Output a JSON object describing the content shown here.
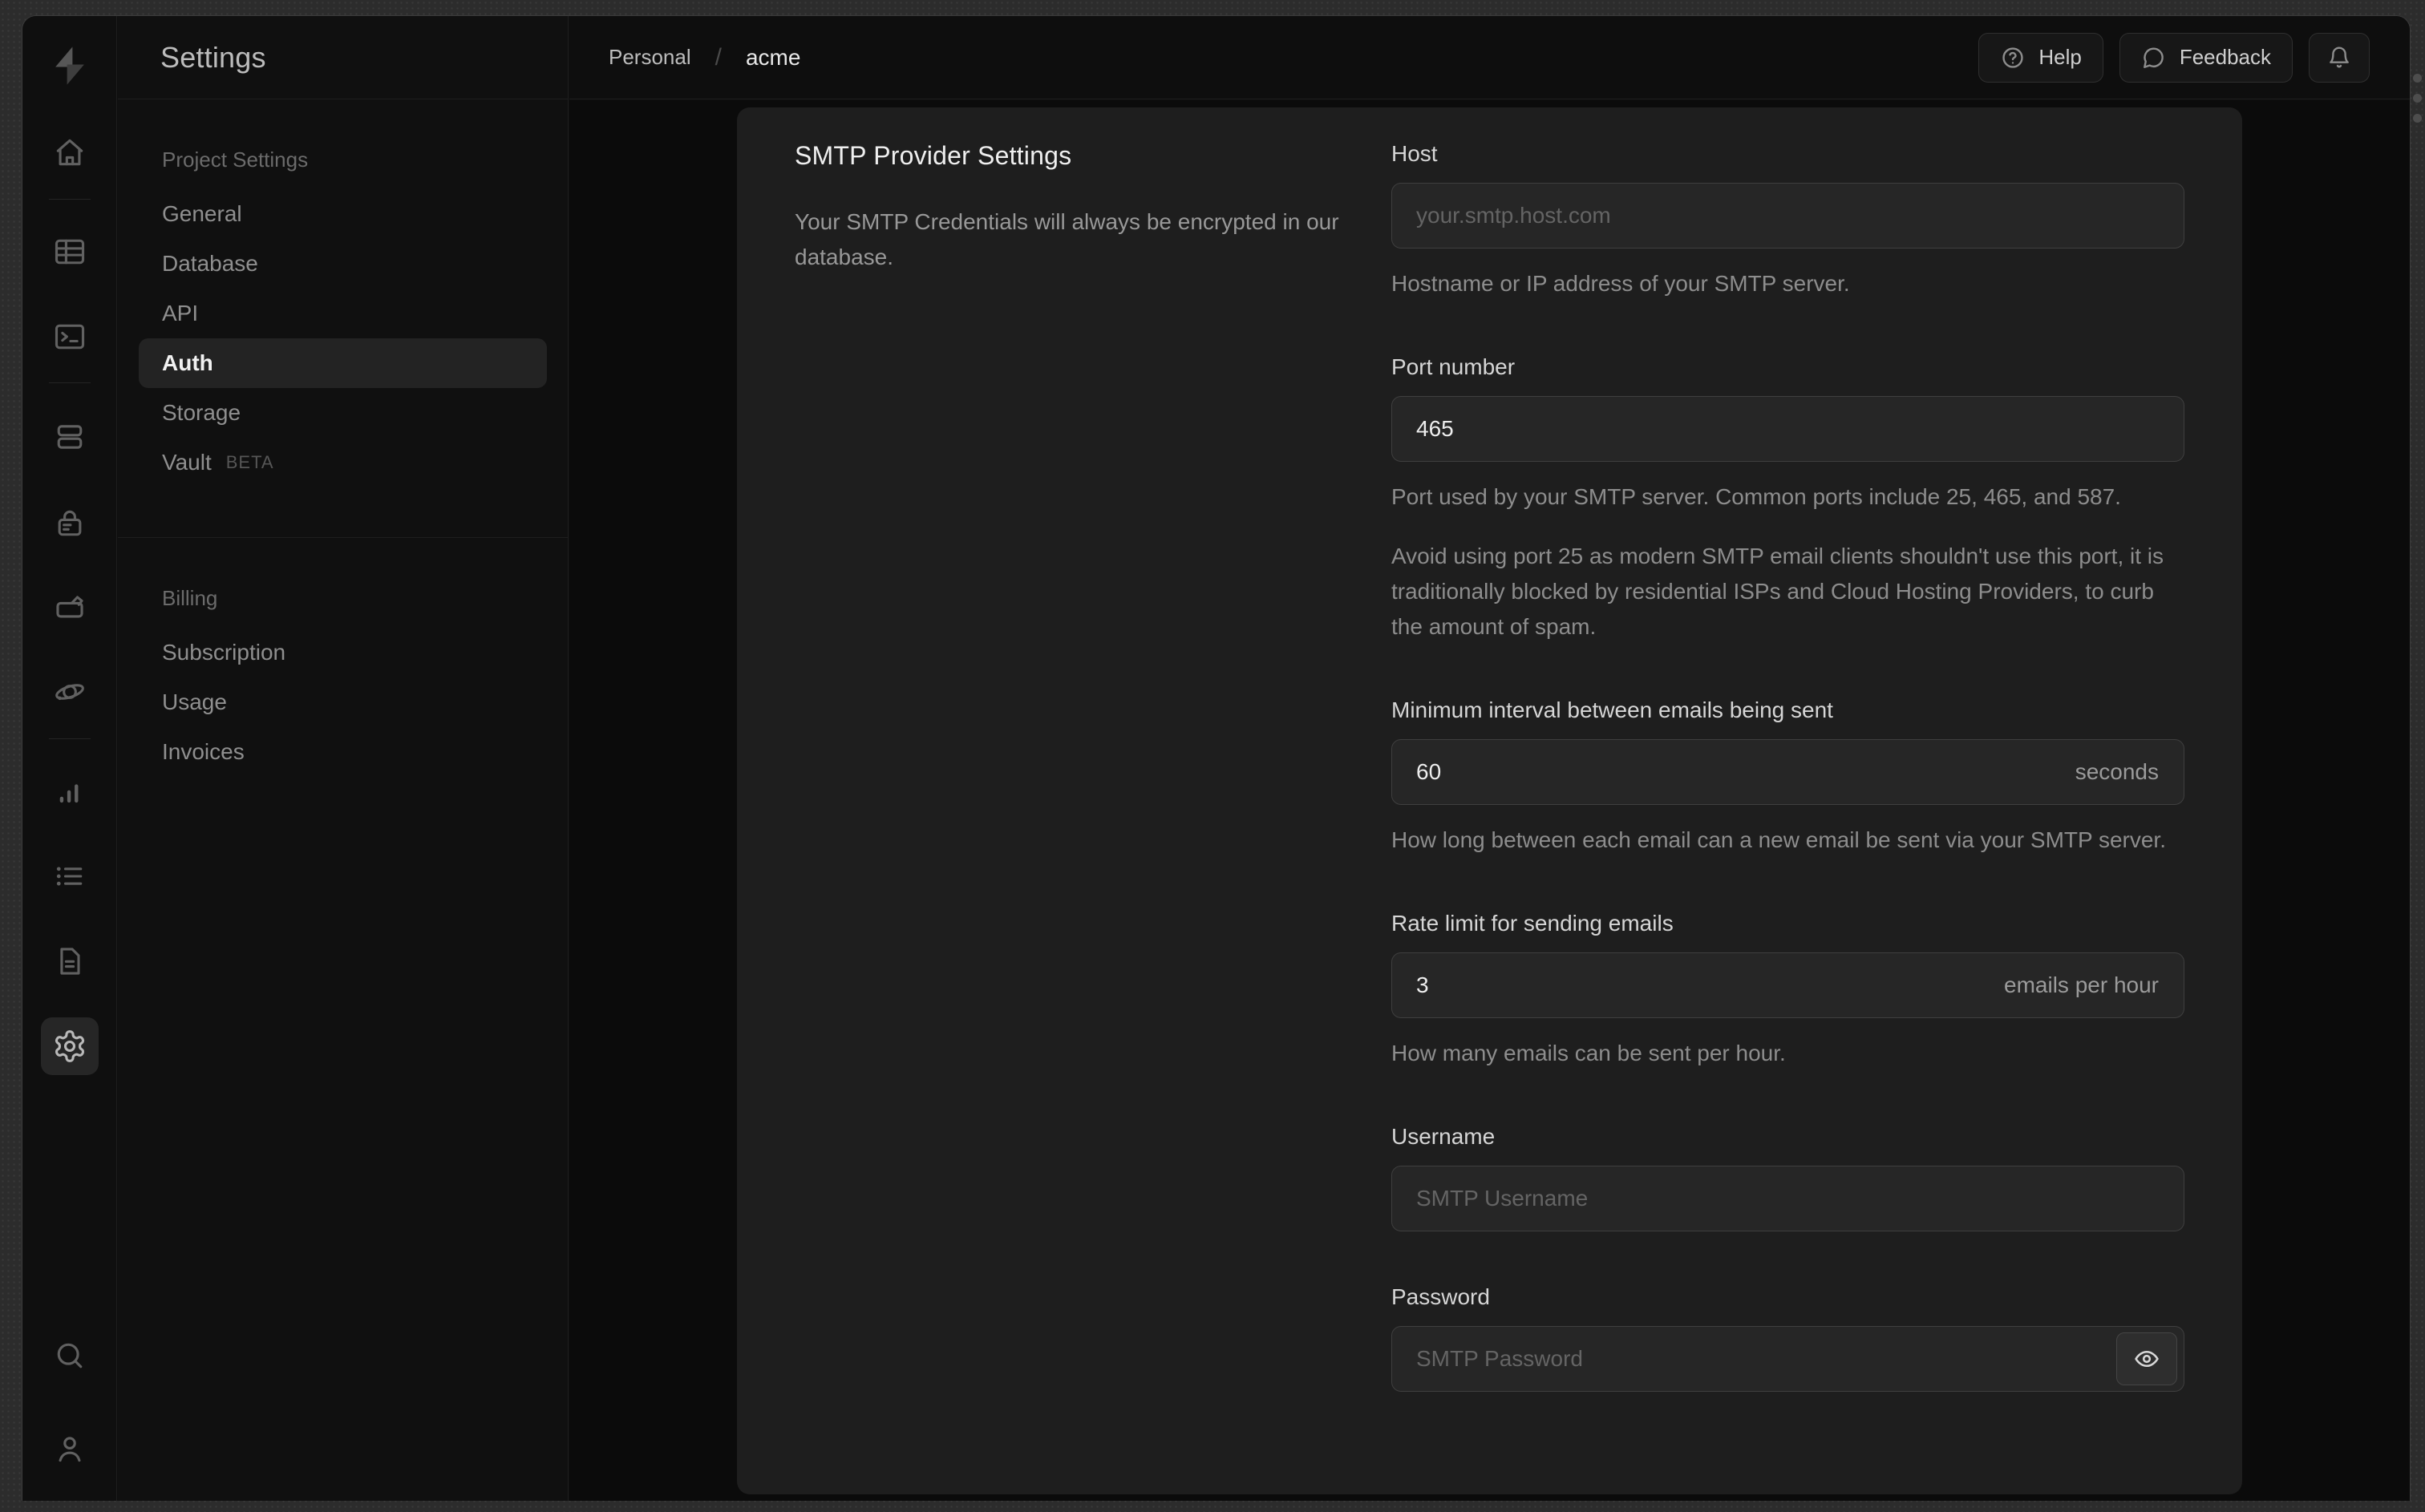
{
  "nav": {
    "title": "Settings",
    "sections": [
      {
        "label": "Project Settings",
        "items": [
          "General",
          "Database",
          "API",
          "Auth",
          "Storage",
          "Vault"
        ]
      },
      {
        "label": "Billing",
        "items": [
          "Subscription",
          "Usage",
          "Invoices"
        ]
      }
    ],
    "active_item": "Auth",
    "vault_badge": "BETA"
  },
  "breadcrumb": {
    "org": "Personal",
    "separator": "/",
    "project": "acme"
  },
  "topbar": {
    "help_label": "Help",
    "feedback_label": "Feedback"
  },
  "smtp": {
    "title": "SMTP Provider Settings",
    "description": "Your SMTP Credentials will always be encrypted in our database.",
    "host": {
      "label": "Host",
      "placeholder": "your.smtp.host.com",
      "helper": "Hostname or IP address of your SMTP server."
    },
    "port": {
      "label": "Port number",
      "value": "465",
      "helper": "Port used by your SMTP server. Common ports include 25, 465, and 587.",
      "note": "Avoid using port 25 as modern SMTP email clients shouldn't use this port, it is traditionally blocked by residential ISPs and Cloud Hosting Providers, to curb the amount of spam."
    },
    "interval": {
      "label": "Minimum interval between emails being sent",
      "value": "60",
      "suffix": "seconds",
      "helper": "How long between each email can a new email be sent via your SMTP server."
    },
    "rate": {
      "label": "Rate limit for sending emails",
      "value": "3",
      "suffix": "emails per hour",
      "helper": "How many emails can be sent per hour."
    },
    "username": {
      "label": "Username",
      "placeholder": "SMTP Username"
    },
    "password": {
      "label": "Password",
      "placeholder": "SMTP Password"
    }
  },
  "colors": {
    "desktop_bg": "#2c2c2c",
    "window_bg": "#0e0e0e",
    "panel_card_bg": "#1e1e1e",
    "input_bg": "#262626",
    "input_border": "#3f3f3f",
    "border_subtle": "#1e1e1e",
    "text_primary": "#ededed",
    "text_secondary": "#8f8f8f",
    "active_pill_bg": "#232323"
  }
}
